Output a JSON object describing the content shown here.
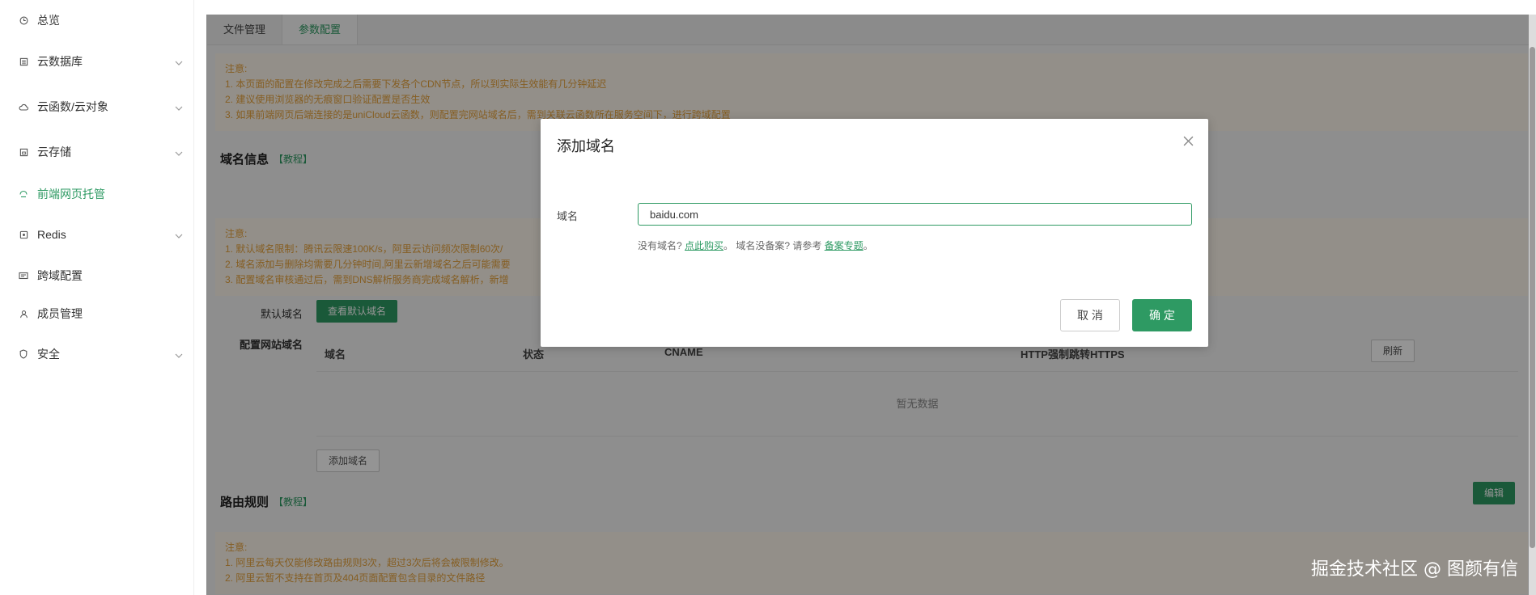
{
  "sidebar": {
    "items": [
      {
        "label": "总览",
        "icon": "clock-icon",
        "has_chevron": false
      },
      {
        "label": "云数据库",
        "icon": "database-icon",
        "has_chevron": true
      },
      {
        "label": "云函数/云对象",
        "icon": "cloud-icon",
        "has_chevron": true
      },
      {
        "label": "云存储",
        "icon": "storage-icon",
        "has_chevron": true
      },
      {
        "label": "前端网页托管",
        "icon": "web-hosting-icon",
        "has_chevron": false,
        "active": true
      },
      {
        "label": "Redis",
        "icon": "redis-icon",
        "has_chevron": true
      },
      {
        "label": "跨域配置",
        "icon": "cors-icon",
        "has_chevron": false
      },
      {
        "label": "成员管理",
        "icon": "user-icon",
        "has_chevron": false
      },
      {
        "label": "安全",
        "icon": "shield-icon",
        "has_chevron": true
      }
    ]
  },
  "tabs": [
    {
      "label": "文件管理",
      "active": false
    },
    {
      "label": "参数配置",
      "active": true
    }
  ],
  "notice_top": {
    "title": "注意:",
    "lines": [
      "1. 本页面的配置在修改完成之后需要下发各个CDN节点，所以到实际生效能有几分钟延迟",
      "2. 建议使用浏览器的无痕窗口验证配置是否生效",
      "3. 如果前端网页后端连接的是uniCloud云函数，则配置完网站域名后，需到关联云函数所在服务空间下，进行跨域配置"
    ]
  },
  "domain_section": {
    "title": "域名信息",
    "tutorial": "【教程】",
    "notice_title": "注意:",
    "notice_lines": [
      "1. 默认域名限制：腾讯云限速100K/s，阿里云访问频次限制60次/",
      "2. 域名添加与删除均需要几分钟时间,阿里云新增域名之后可能需要",
      "3. 配置域名审核通过后，需到DNS解析服务商完成域名解析，新增"
    ],
    "default_domain_label": "默认域名",
    "view_default_button": "查看默认域名",
    "config_domain_label": "配置网站域名",
    "table_headers": [
      "域名",
      "状态",
      "CNAME",
      "HTTP强制跳转HTTPS"
    ],
    "refresh_button": "刷新",
    "empty_text": "暂无数据",
    "add_domain_button": "添加域名"
  },
  "route_section": {
    "title": "路由规则",
    "tutorial": "【教程】",
    "edit_button": "编辑",
    "notice_title": "注意:",
    "notice_lines": [
      "1. 阿里云每天仅能修改路由规则3次，超过3次后将会被限制修改。",
      "2. 阿里云暂不支持在首页及404页面配置包含目录的文件路径"
    ]
  },
  "modal": {
    "title": "添加域名",
    "field_label": "域名",
    "field_value": "baidu.com",
    "help_prefix": "没有域名? ",
    "help_buy_link": "点此购买",
    "help_middle": "。 域名没备案? 请参考 ",
    "help_filing_link": "备案专题",
    "help_suffix": "。",
    "cancel_button": "取 消",
    "ok_button": "确 定"
  },
  "watermark": "掘金技术社区 @ 图颜有信",
  "colors": {
    "accent": "#2e9a63",
    "notice_bg": "#fdf6ec",
    "notice_text": "#e6a23c"
  }
}
